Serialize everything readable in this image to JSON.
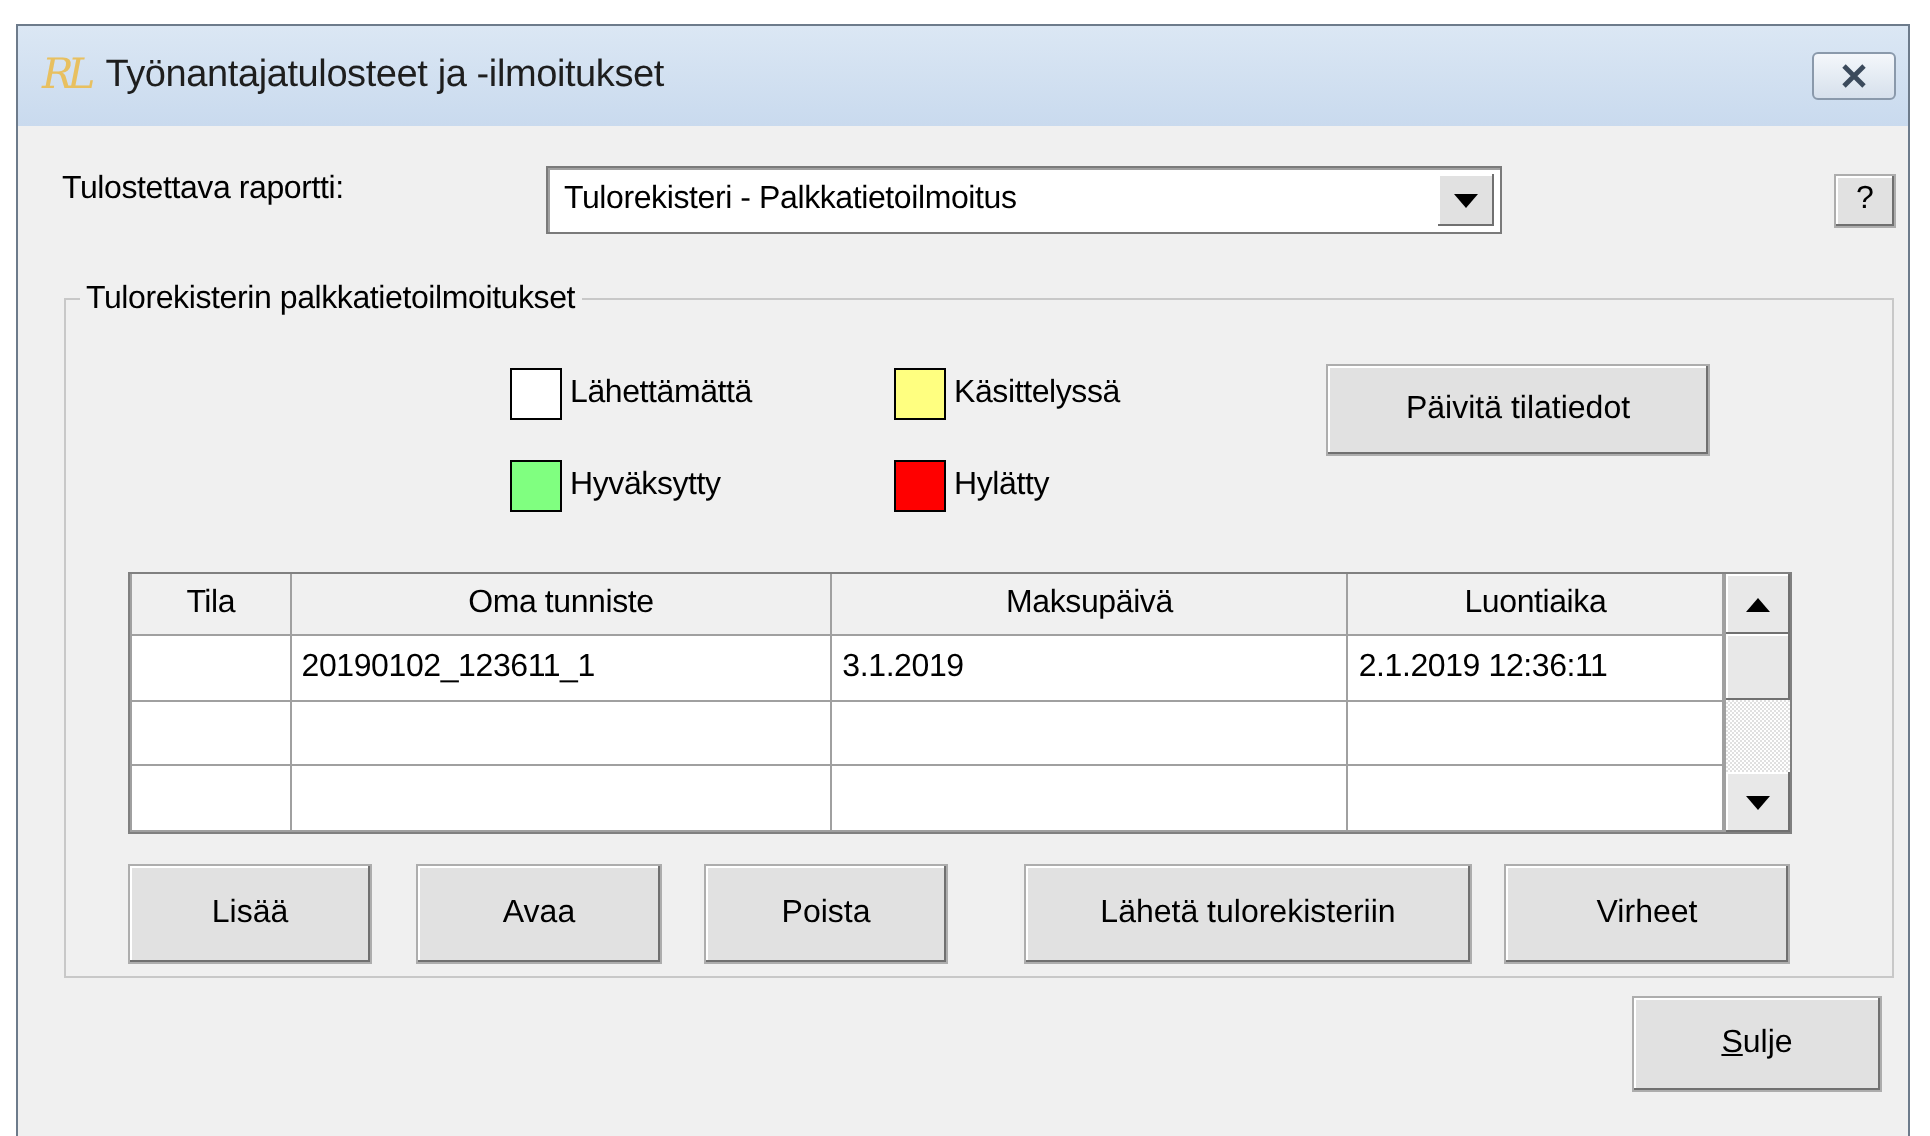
{
  "window": {
    "logo": "RL",
    "title": "Työnantajatulosteet ja -ilmoitukset"
  },
  "report": {
    "label": "Tulostettava raportti:",
    "value": "Tulorekisteri - Palkkatietoilmoitus"
  },
  "help_button": "?",
  "group": {
    "title": "Tulorekisterin palkkatietoilmoitukset",
    "legend": [
      {
        "label": "Lähettämättä",
        "color": "#ffffff"
      },
      {
        "label": "Käsittelyssä",
        "color": "#ffff80"
      },
      {
        "label": "Hyväksytty",
        "color": "#80ff80"
      },
      {
        "label": "Hylätty",
        "color": "#ff0000"
      }
    ],
    "refresh_button": "Päivitä tilatiedot",
    "table": {
      "columns": [
        "Tila",
        "Oma tunniste",
        "Maksupäivä",
        "Luontiaika"
      ],
      "rows": [
        {
          "tunniste": "20190102_123611_1",
          "maksupaiva": "3.1.2019",
          "luontiaika": "2.1.2019 12:36:11"
        }
      ]
    },
    "buttons": [
      "Lisää",
      "Avaa",
      "Poista",
      "Lähetä tulorekisteriin",
      "Virheet"
    ]
  },
  "close_button": {
    "label": "Sulje",
    "mnemonic_underlined": true
  }
}
